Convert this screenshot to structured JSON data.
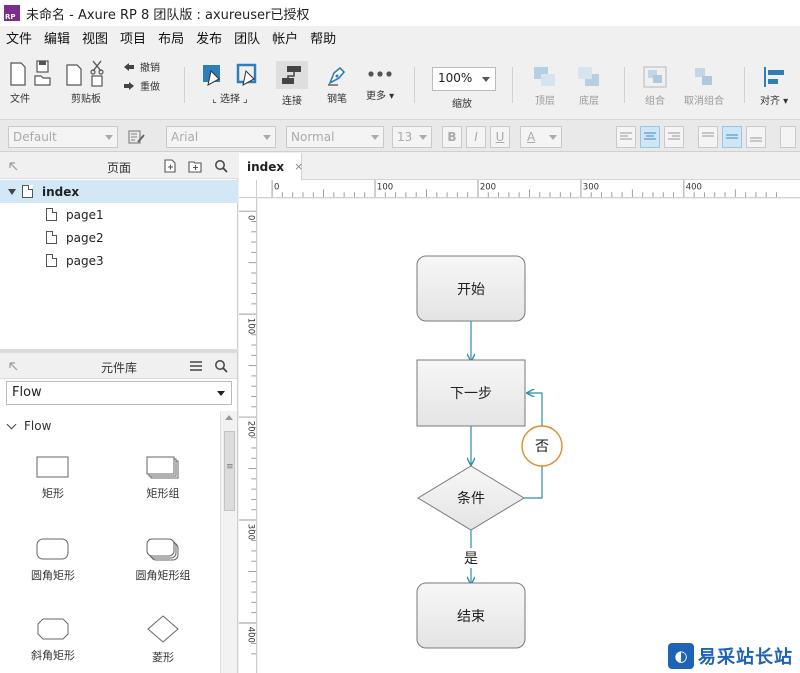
{
  "window": {
    "logo_text": "RP",
    "title": "未命名 - Axure RP 8 团队版 : axureuser已授权"
  },
  "menu": [
    "文件",
    "编辑",
    "视图",
    "项目",
    "布局",
    "发布",
    "团队",
    "帐户",
    "帮助"
  ],
  "toolbar": {
    "file_label": "文件",
    "clipboard_label": "剪贴板",
    "undo_label": "撤销",
    "redo_label": "重做",
    "select_label": "选择",
    "connect_label": "连接",
    "pen_label": "钢笔",
    "more_label": "更多 ▾",
    "zoom_value": "100%",
    "zoom_label": "缩放",
    "top_label": "顶层",
    "bottom_label": "底层",
    "group_label": "组合",
    "ungroup_label": "取消组合",
    "align_label": "对齐 ▾"
  },
  "format_bar": {
    "style": "Default",
    "font": "Arial",
    "weight": "Normal",
    "size": "13",
    "bold": "B",
    "italic": "I",
    "underline": "U",
    "text_color": "A"
  },
  "pages_panel": {
    "title": "页面",
    "pages": [
      {
        "label": "index",
        "selected": true,
        "expanded": true,
        "level": 0
      },
      {
        "label": "page1",
        "level": 1
      },
      {
        "label": "page2",
        "level": 1
      },
      {
        "label": "page3",
        "level": 1
      }
    ]
  },
  "library_panel": {
    "title": "元件库",
    "selected_library": "Flow",
    "group_label": "Flow",
    "widgets": [
      {
        "label": "矩形",
        "shape": "rect"
      },
      {
        "label": "矩形组",
        "shape": "rect-stack"
      },
      {
        "label": "圆角矩形",
        "shape": "rounded-rect"
      },
      {
        "label": "圆角矩形组",
        "shape": "rounded-rect-stack"
      },
      {
        "label": "斜角矩形",
        "shape": "bevel-rect"
      },
      {
        "label": "菱形",
        "shape": "diamond"
      }
    ]
  },
  "canvas": {
    "tab_label": "index",
    "tab_close": "×",
    "ruler_h_labels": [
      "0",
      "100",
      "200",
      "300",
      "400"
    ],
    "ruler_v_labels": [
      "0",
      "100",
      "200",
      "300",
      "400"
    ],
    "flow": {
      "start": "开始",
      "next": "下一步",
      "condition": "条件",
      "no_label": "否",
      "yes_label": "是",
      "end": "结束"
    },
    "colors": {
      "connector": "#2d8ea8",
      "no_circle": "#e08a2c",
      "node_fill": "#ececec",
      "node_border": "#7a7a7a"
    }
  },
  "watermark": {
    "text": "易采站长站"
  }
}
